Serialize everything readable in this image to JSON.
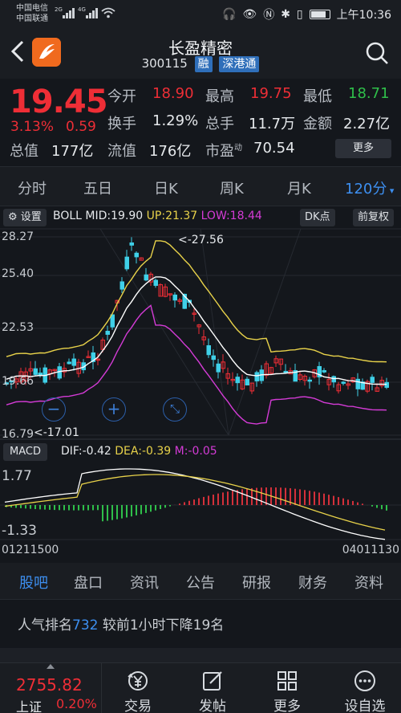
{
  "status": {
    "carrier1": "中国电信",
    "carrier2": "中国联通",
    "net1": "2G",
    "net2": "4G",
    "time": "上午10:36"
  },
  "header": {
    "stock_name": "长盈精密",
    "code": "300115",
    "tag1": "融",
    "tag2": "深港通"
  },
  "quote": {
    "price": "19.45",
    "change_pct": "3.13%",
    "change_amt": "0.59",
    "rows": [
      [
        {
          "label": "今开",
          "value": "18.90",
          "color": "red"
        },
        {
          "label": "最高",
          "value": "19.75",
          "color": "red"
        },
        {
          "label": "最低",
          "value": "18.71",
          "color": "green"
        }
      ],
      [
        {
          "label": "换手",
          "value": "1.29%",
          "color": "white"
        },
        {
          "label": "总手",
          "value": "11.7万",
          "color": "white"
        },
        {
          "label": "金额",
          "value": "2.27亿",
          "color": "white"
        }
      ],
      [
        {
          "label": "总值",
          "value": "177亿",
          "color": "white"
        },
        {
          "label": "流值",
          "value": "176亿",
          "color": "white"
        },
        {
          "label": "市盈",
          "sup": "动",
          "value": "70.54",
          "color": "white"
        }
      ]
    ],
    "more_label": "更多"
  },
  "period_tabs": [
    {
      "label": "分时",
      "active": false
    },
    {
      "label": "五日",
      "active": false
    },
    {
      "label": "日K",
      "active": false
    },
    {
      "label": "周K",
      "active": false
    },
    {
      "label": "月K",
      "active": false
    },
    {
      "label": "120分",
      "active": true
    }
  ],
  "chart": {
    "settings_label": "设置",
    "boll_mid": "BOLL MID:19.90",
    "boll_up": "UP:21.37",
    "boll_low": "LOW:18.44",
    "dk_label": "DK点",
    "adj_label": "前复权",
    "y_labels": [
      "28.27",
      "25.40",
      "22.53",
      "19.66",
      "16.79"
    ],
    "max_marker": "<-27.56",
    "min_marker": "<-17.01",
    "macd_label": "MACD",
    "dif": "DIF:-0.42",
    "dea": "DEA:-0.39",
    "m": "M:-0.05",
    "macd_y_top": "1.77",
    "macd_y_bottom": "-1.33",
    "time_start": "01211500",
    "time_end": "04011130",
    "colors": {
      "up": "#ee2e36",
      "down": "#3fd0e8",
      "mid": "#ffffff",
      "upper": "#e8d24a",
      "lower": "#d43bd6",
      "dif": "#ffffff",
      "dea": "#e8d24a"
    }
  },
  "section_tabs": [
    {
      "label": "股吧",
      "active": true
    },
    {
      "label": "盘口",
      "active": false
    },
    {
      "label": "资讯",
      "active": false
    },
    {
      "label": "公告",
      "active": false
    },
    {
      "label": "研报",
      "active": false
    },
    {
      "label": "财务",
      "active": false
    },
    {
      "label": "资料",
      "active": false
    }
  ],
  "popularity": {
    "prefix": "人气排名",
    "rank": "732",
    "suffix": "较前1小时下降19名"
  },
  "bottom": {
    "index_value": "2755.82",
    "index_name": "上证",
    "index_pct": "0.20%",
    "nav": [
      {
        "label": "交易",
        "icon": "trade-icon"
      },
      {
        "label": "发帖",
        "icon": "compose-icon"
      },
      {
        "label": "更多",
        "icon": "grid-icon"
      },
      {
        "label": "设自选",
        "icon": "favorite-icon"
      }
    ]
  }
}
